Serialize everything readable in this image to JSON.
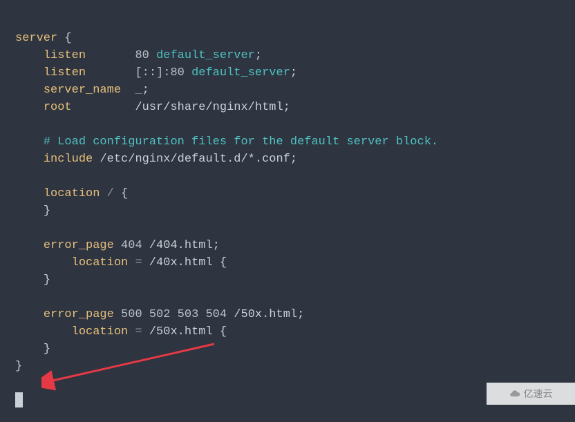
{
  "code": {
    "server": "server",
    "brace_open": "{",
    "brace_close": "}",
    "listen": "listen",
    "port80": "80",
    "default_server": "default_server",
    "semicolon": ";",
    "ipv6_prefix": "[::]:",
    "ipv6_port": "80",
    "server_name": "server_name",
    "underscore": "_",
    "root": "root",
    "root_path": "/usr/share/nginx/html",
    "comment": "# Load configuration files for the default server block.",
    "include": "include",
    "include_path": "/etc/nginx/default.d/*.conf",
    "location": "location",
    "slash": "/",
    "error_page": "error_page",
    "code404": "404",
    "path404": "/404.html",
    "eq": "=",
    "path40x": "/40x.html",
    "code500": "500",
    "code502": "502",
    "code503": "503",
    "code504": "504",
    "path50x": "/50x.html",
    "loc50x": "/50x.html"
  },
  "watermark": {
    "text": "亿速云"
  }
}
